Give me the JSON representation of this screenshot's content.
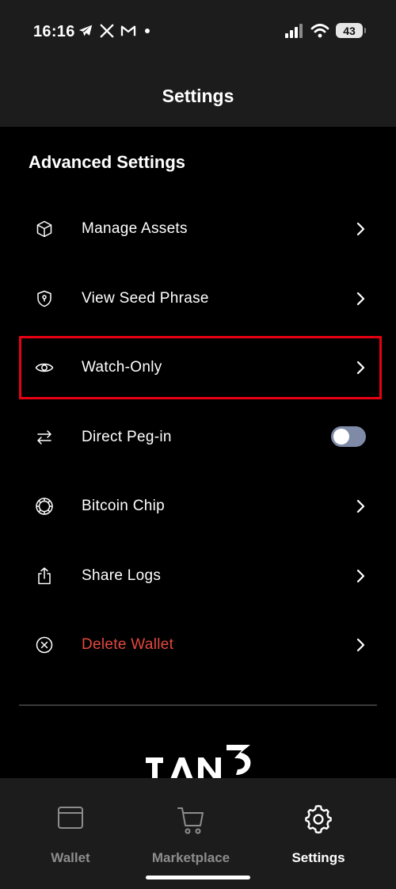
{
  "status_bar": {
    "time": "16:16",
    "battery": "43",
    "app_icons": [
      "telegram-icon",
      "x-icon",
      "gmail-icon",
      "dot-icon"
    ]
  },
  "header": {
    "title": "Settings"
  },
  "section": {
    "title": "Advanced Settings"
  },
  "menu": {
    "items": [
      {
        "label": "Manage Assets",
        "icon": "cube-icon",
        "control": "chevron"
      },
      {
        "label": "View Seed Phrase",
        "icon": "shield-key-icon",
        "control": "chevron"
      },
      {
        "label": "Watch-Only",
        "icon": "eye-icon",
        "control": "chevron",
        "highlighted": true
      },
      {
        "label": "Direct Peg-in",
        "icon": "swap-arrows-icon",
        "control": "toggle",
        "toggle_on": false
      },
      {
        "label": "Bitcoin Chip",
        "icon": "chip-icon",
        "control": "chevron"
      },
      {
        "label": "Share Logs",
        "icon": "share-icon",
        "control": "chevron"
      },
      {
        "label": "Delete Wallet",
        "icon": "close-circle-icon",
        "control": "chevron",
        "danger": true
      }
    ]
  },
  "colors": {
    "danger": "#e5483f",
    "highlight_border": "#e60012",
    "toggle_off": "#7e8aa6"
  },
  "tab_bar": {
    "tabs": [
      {
        "label": "Wallet",
        "icon": "wallet-icon",
        "active": false
      },
      {
        "label": "Marketplace",
        "icon": "cart-icon",
        "active": false
      },
      {
        "label": "Settings",
        "icon": "gear-icon",
        "active": true
      }
    ]
  }
}
